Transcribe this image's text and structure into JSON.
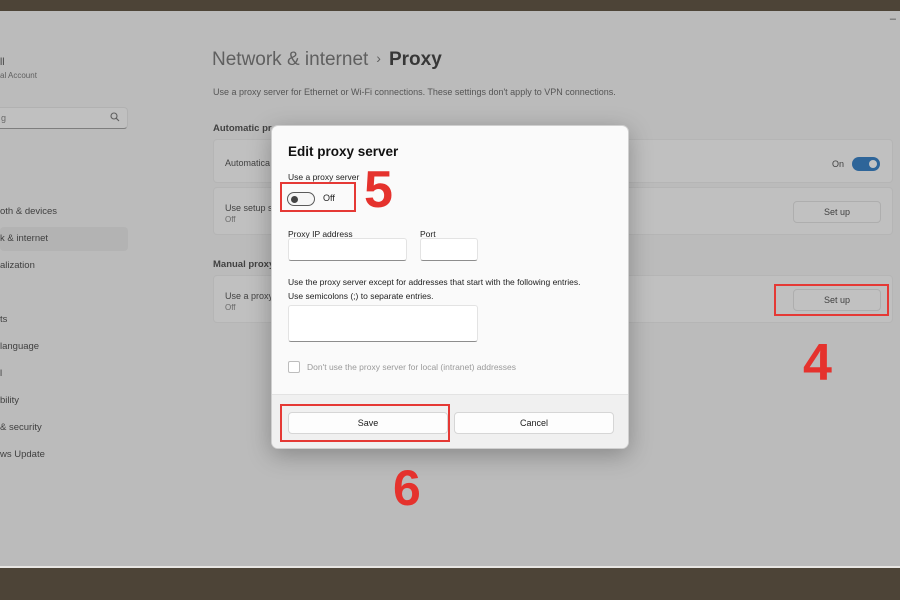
{
  "window": {
    "minimize_glyph": "–"
  },
  "user": {
    "name": "ll",
    "account": "al Account"
  },
  "sidebar": {
    "search_placeholder": "g",
    "search_icon": "search-icon",
    "items": [
      {
        "label": "oth & devices",
        "active": false
      },
      {
        "label": "k & internet",
        "active": true
      },
      {
        "label": "alization",
        "active": false
      },
      {
        "label": "ts",
        "active": false
      },
      {
        "label": " language",
        "active": false
      },
      {
        "label": "l",
        "active": false
      },
      {
        "label": "bility",
        "active": false
      },
      {
        "label": "& security",
        "active": false
      },
      {
        "label": "ws Update",
        "active": false
      }
    ]
  },
  "header": {
    "parent": "Network & internet",
    "separator": "›",
    "current": "Proxy",
    "description": "Use a proxy server for Ethernet or Wi-Fi connections. These settings don't apply to VPN connections."
  },
  "automatic": {
    "section_label": "Automatic pr",
    "detect_label": "Automatica",
    "detect_state": "On",
    "script_label": "Use setup s",
    "script_state": "Off",
    "script_button": "Set up"
  },
  "manual": {
    "section_label": "Manual proxy",
    "use_label": "Use a proxy",
    "use_state": "Off",
    "setup_button": "Set up"
  },
  "dialog": {
    "title": "Edit proxy server",
    "use_proxy_label": "Use a proxy server",
    "toggle_state": "Off",
    "ip_label": "Proxy IP address",
    "port_label": "Port",
    "exceptions_line1": "Use the proxy server except for addresses that start with the following entries.",
    "exceptions_line2": "Use semicolons (;) to separate entries.",
    "local_checkbox_label": "Don't use the proxy server for local (intranet) addresses",
    "save_button": "Save",
    "cancel_button": "Cancel"
  },
  "annotations": {
    "step_toggle": "5",
    "step_setup": "4",
    "step_save": "6",
    "color": "#e5322d"
  },
  "colors": {
    "accent": "#005fb8",
    "highlight": "#e53935"
  }
}
